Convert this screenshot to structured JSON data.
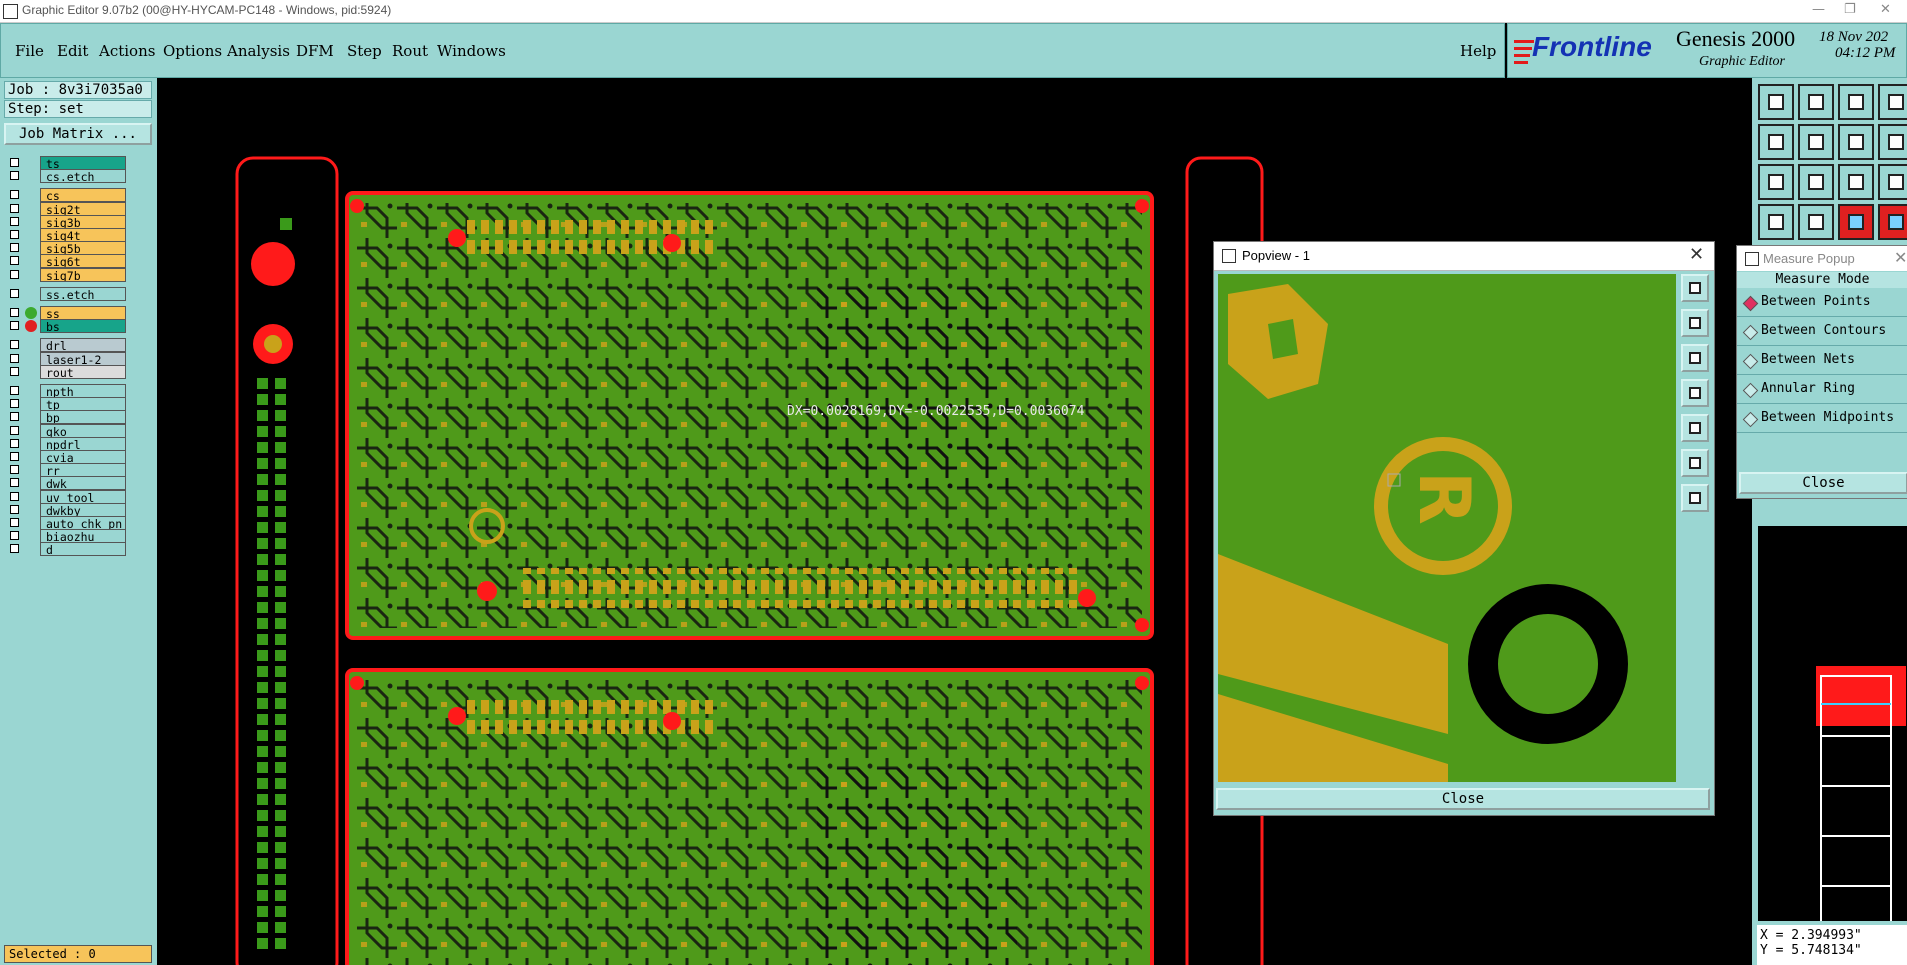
{
  "window": {
    "title": "Graphic Editor 9.07b2 (00@HY-HYCAM-PC148 - Windows, pid:5924)",
    "minimize": "—",
    "restore": "❐",
    "close": "✕"
  },
  "menu": {
    "file": "File",
    "edit": "Edit",
    "actions": "Actions",
    "options": "Options",
    "analysis": "Analysis",
    "dfm": "DFM",
    "step": "Step",
    "rout": "Rout",
    "windows": "Windows",
    "help": "Help"
  },
  "brand": {
    "logo": "Frontline",
    "product": "Genesis 2000",
    "subtitle": "Graphic Editor",
    "date": "18 Nov 202",
    "time": "04:12 PM"
  },
  "job_panel": {
    "job": "Job : 8v3i7035a0",
    "step": "Step: set",
    "job_matrix": "Job Matrix ..."
  },
  "layers": [
    {
      "name": "ts",
      "bg": "#17a48a",
      "dot": "",
      "group": 0
    },
    {
      "name": "cs.etch",
      "bg": "#9ad6d2",
      "dot": "",
      "group": 0
    },
    {
      "name": "cs",
      "bg": "#f7c45a",
      "dot": "",
      "group": 1
    },
    {
      "name": "sig2t",
      "bg": "#f7c45a",
      "dot": "",
      "group": 1
    },
    {
      "name": "sig3b",
      "bg": "#f7c45a",
      "dot": "",
      "group": 1
    },
    {
      "name": "sig4t",
      "bg": "#f7c45a",
      "dot": "",
      "group": 1
    },
    {
      "name": "sig5b",
      "bg": "#f7c45a",
      "dot": "",
      "group": 1
    },
    {
      "name": "sig6t",
      "bg": "#f7c45a",
      "dot": "",
      "group": 1
    },
    {
      "name": "sig7b",
      "bg": "#f7c45a",
      "dot": "",
      "group": 1
    },
    {
      "name": "ss.etch",
      "bg": "#9ad6d2",
      "dot": "",
      "group": 2
    },
    {
      "name": "ss",
      "bg": "#f7c45a",
      "dot": "#3caa2e",
      "group": 3
    },
    {
      "name": "bs",
      "bg": "#17a48a",
      "dot": "#e02020",
      "group": 3
    },
    {
      "name": "drl",
      "bg": "#b9cad0",
      "dot": "",
      "group": 4
    },
    {
      "name": "laser1-2",
      "bg": "#b9cad0",
      "dot": "",
      "group": 4
    },
    {
      "name": "rout",
      "bg": "#dcdcdc",
      "dot": "",
      "group": 4
    },
    {
      "name": "npth",
      "bg": "#9ad6d2",
      "dot": "",
      "group": 5
    },
    {
      "name": "tp",
      "bg": "#9ad6d2",
      "dot": "",
      "group": 5
    },
    {
      "name": "bp",
      "bg": "#9ad6d2",
      "dot": "",
      "group": 5
    },
    {
      "name": "gko",
      "bg": "#9ad6d2",
      "dot": "",
      "group": 5
    },
    {
      "name": "npdrl",
      "bg": "#9ad6d2",
      "dot": "",
      "group": 5
    },
    {
      "name": "cvia",
      "bg": "#9ad6d2",
      "dot": "",
      "group": 5
    },
    {
      "name": "rr",
      "bg": "#9ad6d2",
      "dot": "",
      "group": 5
    },
    {
      "name": "dwk",
      "bg": "#9ad6d2",
      "dot": "",
      "group": 5
    },
    {
      "name": "uv_tool",
      "bg": "#9ad6d2",
      "dot": "",
      "group": 5
    },
    {
      "name": "dwkby",
      "bg": "#9ad6d2",
      "dot": "",
      "group": 5
    },
    {
      "name": "auto_chk_pn",
      "bg": "#9ad6d2",
      "dot": "",
      "group": 5
    },
    {
      "name": "biaozhu",
      "bg": "#9ad6d2",
      "dot": "",
      "group": 5
    },
    {
      "name": "d",
      "bg": "#9ad6d2",
      "dot": "",
      "group": 5
    }
  ],
  "status": {
    "selected": "Selected : 0"
  },
  "measurement_readout": "DX=0.0028169,DY=-0.0022535,D=0.0036074",
  "popview": {
    "title": "Popview - 1",
    "close": "Close"
  },
  "measure_popup": {
    "title": "Measure Popup",
    "mode_header": "Measure Mode",
    "options": [
      "Between Points",
      "Between Contours",
      "Between Nets",
      "Annular Ring",
      "Between Midpoints"
    ],
    "selected": "Between Points",
    "close": "Close"
  },
  "coordinates": {
    "x": "X = 2.394993\"",
    "y": "Y = 5.748134\""
  },
  "colors": {
    "panel": "#9ad6d2",
    "board_green": "#4f9a1a",
    "copper": "#c9a21a",
    "profile_red": "#ff1a1a"
  },
  "toolbar_icons": [
    "send-to-back-icon",
    "bring-to-front-icon",
    "home-icon",
    "window-icon",
    "move-left-icon",
    "move-right-icon",
    "split-icon",
    "text-icon",
    "fit-icon",
    "center-icon",
    "zoom-ratio-icon",
    "question-icon",
    "settings-icon",
    "grid-icon",
    "net-icon",
    "net-alt-icon"
  ]
}
